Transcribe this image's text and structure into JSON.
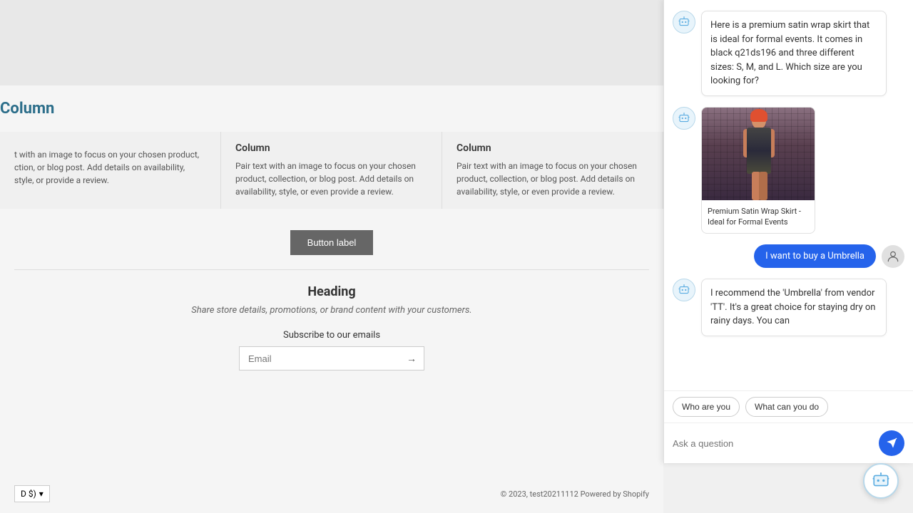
{
  "page": {
    "heading": "Column",
    "top_area_bg": "#e8e8e8"
  },
  "columns": [
    {
      "title": "",
      "text": "t with an image to focus on your chosen product, ction, or blog post. Add details on availability, style, or provide a review."
    },
    {
      "title": "Column",
      "text": "Pair text with an image to focus on your chosen product, collection, or blog post. Add details on availability, style, or even provide a review."
    },
    {
      "title": "Column",
      "text": "Pair text with an image to focus on your chosen product, collection, or blog post. Add details on availability, style, or even provide a review."
    }
  ],
  "button": {
    "label": "Button label"
  },
  "heading_section": {
    "title": "Heading",
    "subtitle": "Share store details, promotions, or brand content with your customers."
  },
  "email_section": {
    "label": "Subscribe to our emails",
    "placeholder": "Email"
  },
  "footer": {
    "currency": "D $)",
    "copyright": "© 2023, test20211112",
    "powered": "Powered by Shopify"
  },
  "chat": {
    "bot_message_1": "Here is a premium satin wrap skirt that is ideal for formal events. It comes in black q21ds196 and three different sizes: S, M, and L. Which size are you looking for?",
    "product_title": "Premium Satin Wrap Skirt - Ideal for Formal Events",
    "user_message": "I want to buy a Umbrella",
    "bot_message_2": "I recommend the 'Umbrella' from vendor 'TT'. It's a great choice for staying dry on rainy days. You can",
    "quick_reply_1": "Who are you",
    "quick_reply_2": "What can you do",
    "input_placeholder": "Ask a question"
  }
}
